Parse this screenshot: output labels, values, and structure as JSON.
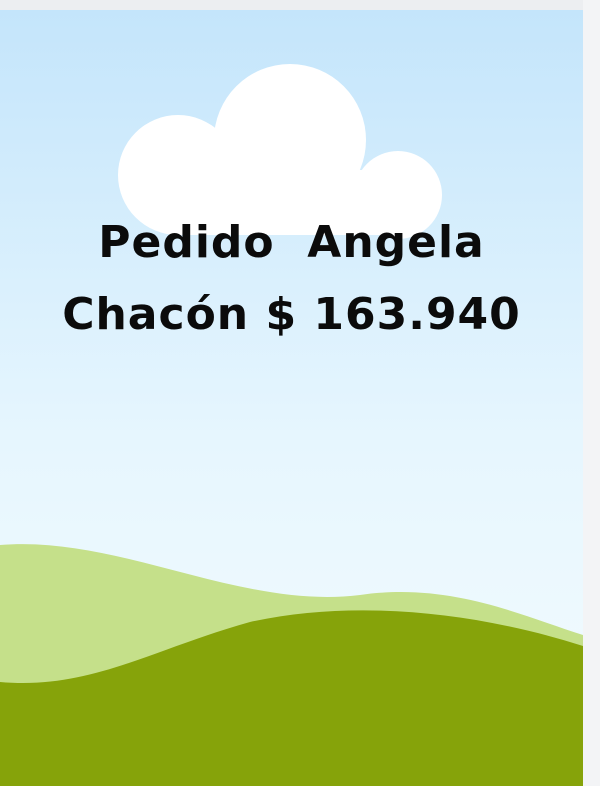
{
  "card": {
    "title_line1": "Pedido  Angela",
    "title_line2": "Chacón $ 163.940"
  },
  "colors": {
    "sky_top": "#c6e6fb",
    "sky_bottom": "#f2fbff",
    "cloud": "#ffffff",
    "hill_back": "#c5e08a",
    "hill_front": "#86a30a",
    "text": "#0b0b0b",
    "frame": "#eceef1"
  },
  "icons": {
    "cloud": "cloud-icon",
    "hills": "hills-illustration"
  }
}
